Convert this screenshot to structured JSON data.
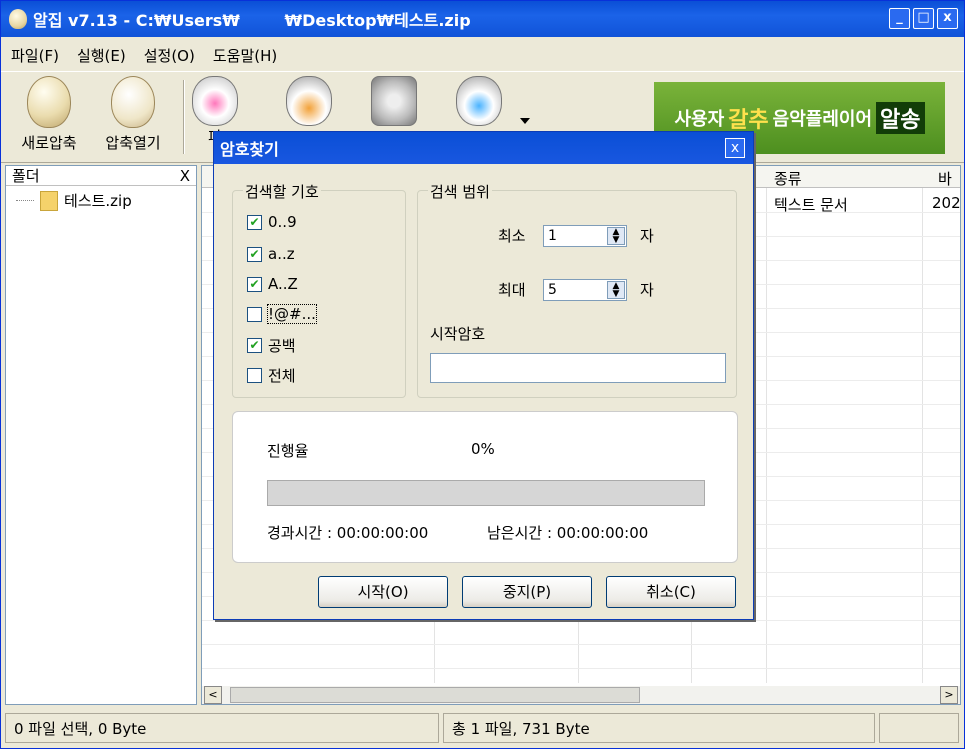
{
  "window": {
    "title": "알집 v7.13 - C:₩Users₩        ₩Desktop₩테스트.zip",
    "minimize": "_",
    "maximize": "□",
    "close": "x"
  },
  "menu": [
    "파일(F)",
    "실행(E)",
    "설정(O)",
    "도움말(H)"
  ],
  "toolbar": {
    "new_compress": "새로압축",
    "open_archive": "압축열기",
    "partial": "파"
  },
  "banner": {
    "pre": "사용자",
    "big": "갈추",
    "mid": "음악플레이어",
    "box": "알송"
  },
  "folder_pane": {
    "header": "폴더",
    "close": "X",
    "item": "테스트.zip"
  },
  "list": {
    "columns": [
      "종류",
      "바"
    ],
    "rows": [
      {
        "type": "텍스트 문서",
        "date": "202"
      }
    ]
  },
  "status": {
    "left": "0 파일 선택, 0 Byte",
    "mid": "총 1 파일, 731 Byte",
    "right": ""
  },
  "dialog": {
    "title": "암호찾기",
    "close": "x",
    "symbols_group": "검색할 기호",
    "symbols": [
      {
        "label": "0..9",
        "checked": true
      },
      {
        "label": "a..z",
        "checked": true
      },
      {
        "label": "A..Z",
        "checked": true
      },
      {
        "label": "!@#...",
        "checked": false
      },
      {
        "label": "공백",
        "checked": true
      },
      {
        "label": "전체",
        "checked": false
      }
    ],
    "range_group": "검색 범위",
    "min_label": "최소",
    "min_value": "1",
    "max_label": "최대",
    "max_value": "5",
    "unit": "자",
    "start_pw_label": "시작암호",
    "start_pw_value": "",
    "progress_label": "진행율",
    "progress_value": "0%",
    "progress_fraction": 0,
    "elapsed": "경과시간 : 00:00:00:00",
    "remaining": "남은시간 : 00:00:00:00",
    "buttons": {
      "start": "시작(O)",
      "stop": "중지(P)",
      "cancel": "취소(C)"
    }
  },
  "colors": {
    "titlebar": "#0a4fd6",
    "check": "#21a121",
    "banner": "#5c9a27"
  }
}
